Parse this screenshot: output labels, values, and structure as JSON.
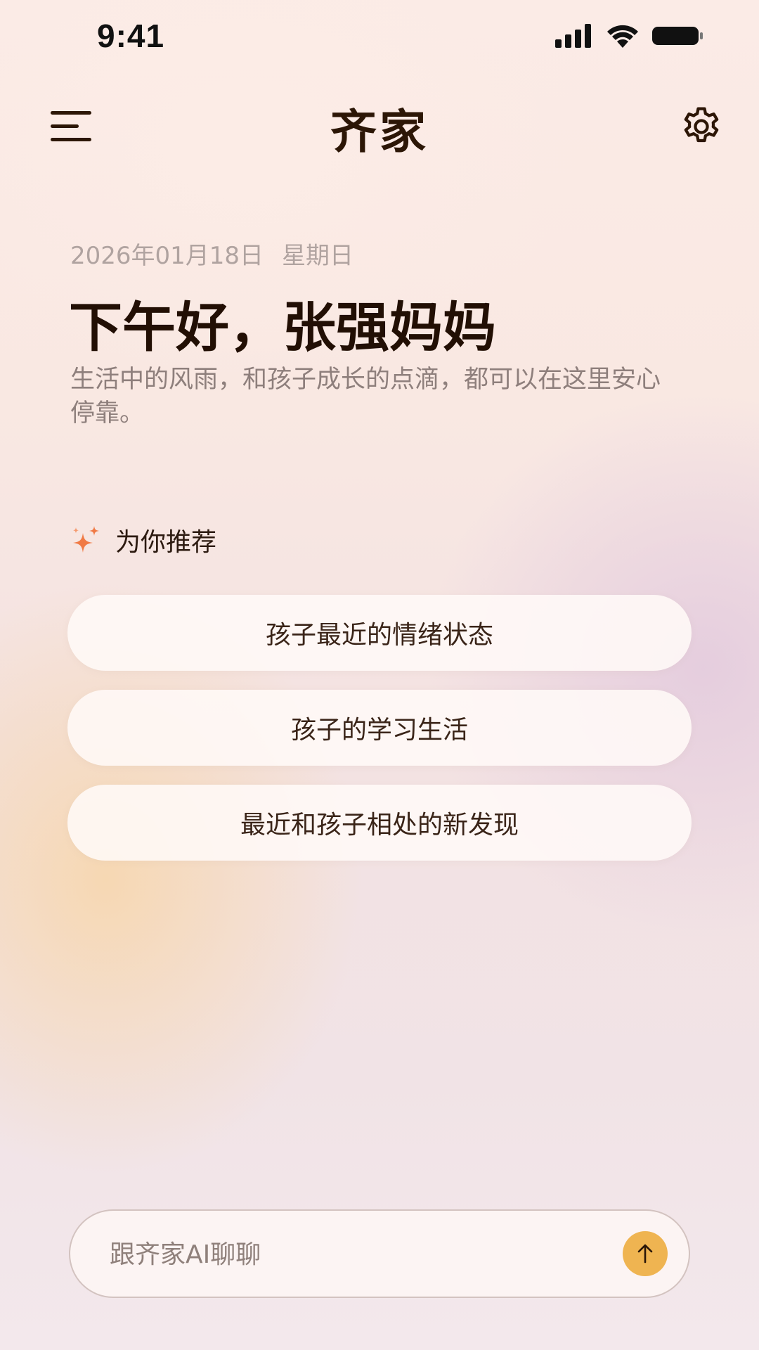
{
  "status_bar": {
    "time": "9:41",
    "icons": [
      "cellular-signal-icon",
      "wifi-icon",
      "battery-icon"
    ]
  },
  "header": {
    "title": "齐家",
    "menu_icon": "hamburger-menu-icon",
    "settings_icon": "gear-icon"
  },
  "greeting": {
    "date": "2026年01月18日",
    "weekday": "星期日",
    "title": "下午好，张强妈妈",
    "subtitle": "生活中的风雨，和孩子成长的点滴，都可以在这里安心停靠。"
  },
  "recommendations": {
    "icon": "sparkle-icon",
    "title": "为你推荐",
    "items": [
      {
        "label": "孩子最近的情绪状态"
      },
      {
        "label": "孩子的学习生活"
      },
      {
        "label": "最近和孩子相处的新发现"
      }
    ]
  },
  "chat": {
    "placeholder": "跟齐家AI聊聊",
    "value": "",
    "send_icon": "arrow-up-icon"
  },
  "colors": {
    "accent": "#efb451",
    "sparkle": "#f07a45",
    "text_primary": "#220f04",
    "text_muted": "#8e7f7c"
  }
}
